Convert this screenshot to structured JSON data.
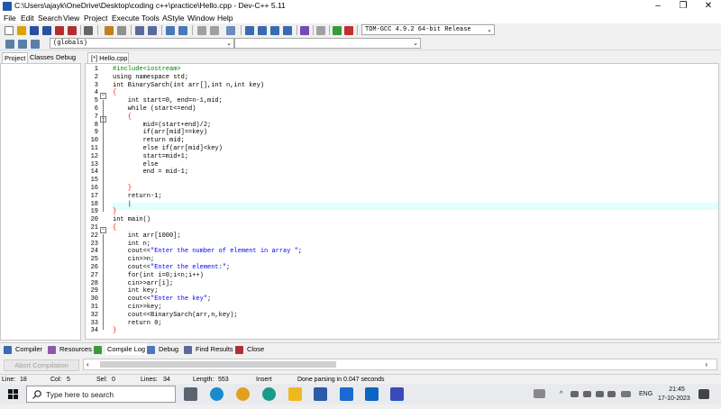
{
  "window": {
    "title": "C:\\Users\\ajayk\\OneDrive\\Desktop\\coding c++\\practice\\Hello.cpp - Dev-C++ 5.11",
    "minimize": "–",
    "maximize": "❐",
    "close": "✕"
  },
  "menu": [
    "File",
    "Edit",
    "Search",
    "View",
    "Project",
    "Execute",
    "Tools",
    "AStyle",
    "Window",
    "Help"
  ],
  "toolbar": {
    "compiler_select": "TDM-GCC 4.9.2 64-bit Release",
    "scope_select": "(globals)"
  },
  "left_tabs": [
    "Project",
    "Classes",
    "Debug"
  ],
  "editor_tab": "[*] Hello.cpp",
  "code_lines": [
    "#include<iostream>",
    "using namespace std;",
    "int BinarySarch(int arr[],int n,int key)",
    "{",
    "    int start=0, end=n-1,mid;",
    "    while (start<=end)",
    "    {",
    "        mid=(start+end)/2;",
    "        if(arr[mid]==key)",
    "        return mid;",
    "        else if(arr[mid]<key)",
    "        start=mid+1;",
    "        else",
    "        end = mid-1;",
    "",
    "    }",
    "    return-1;",
    "    |",
    "}",
    "int main()",
    "{",
    "    int arr[1000];",
    "    int n;",
    "    cout<<\"Enter the number of element in array \";",
    "    cin>>n;",
    "    cout<<\"Enter the element:\";",
    "    for(int i=0;i<n;i++)",
    "    cin>>arr[i];",
    "    int key;",
    "    cout<<\"Enter the key\";",
    "    cin>>key;",
    "    cout<<BinarySarch(arr,n,key);",
    "    return 0;",
    "}"
  ],
  "bottom_tabs": [
    "Compiler",
    "Resources",
    "Compile Log",
    "Debug",
    "Find Results",
    "Close"
  ],
  "abort_button": "Abort Compilation",
  "status": {
    "line_label": "Line:",
    "line": "18",
    "col_label": "Col:",
    "col": "5",
    "sel_label": "Sel:",
    "sel": "0",
    "lines_label": "Lines:",
    "lines": "34",
    "length_label": "Length:",
    "length": "553",
    "mode": "Insert",
    "message": "Done parsing in 0.047 seconds"
  },
  "taskbar": {
    "search_placeholder": "Type here to search",
    "language": "ENG",
    "time": "21:45",
    "date": "17-10-2023"
  },
  "colors": {
    "accent": "#1e5aa8",
    "current_line": "#e0ffff",
    "keyword": "#000000",
    "brace": "#ff0000",
    "number": "#800080",
    "string": "#0000ff",
    "preprocessor": "#008000"
  }
}
